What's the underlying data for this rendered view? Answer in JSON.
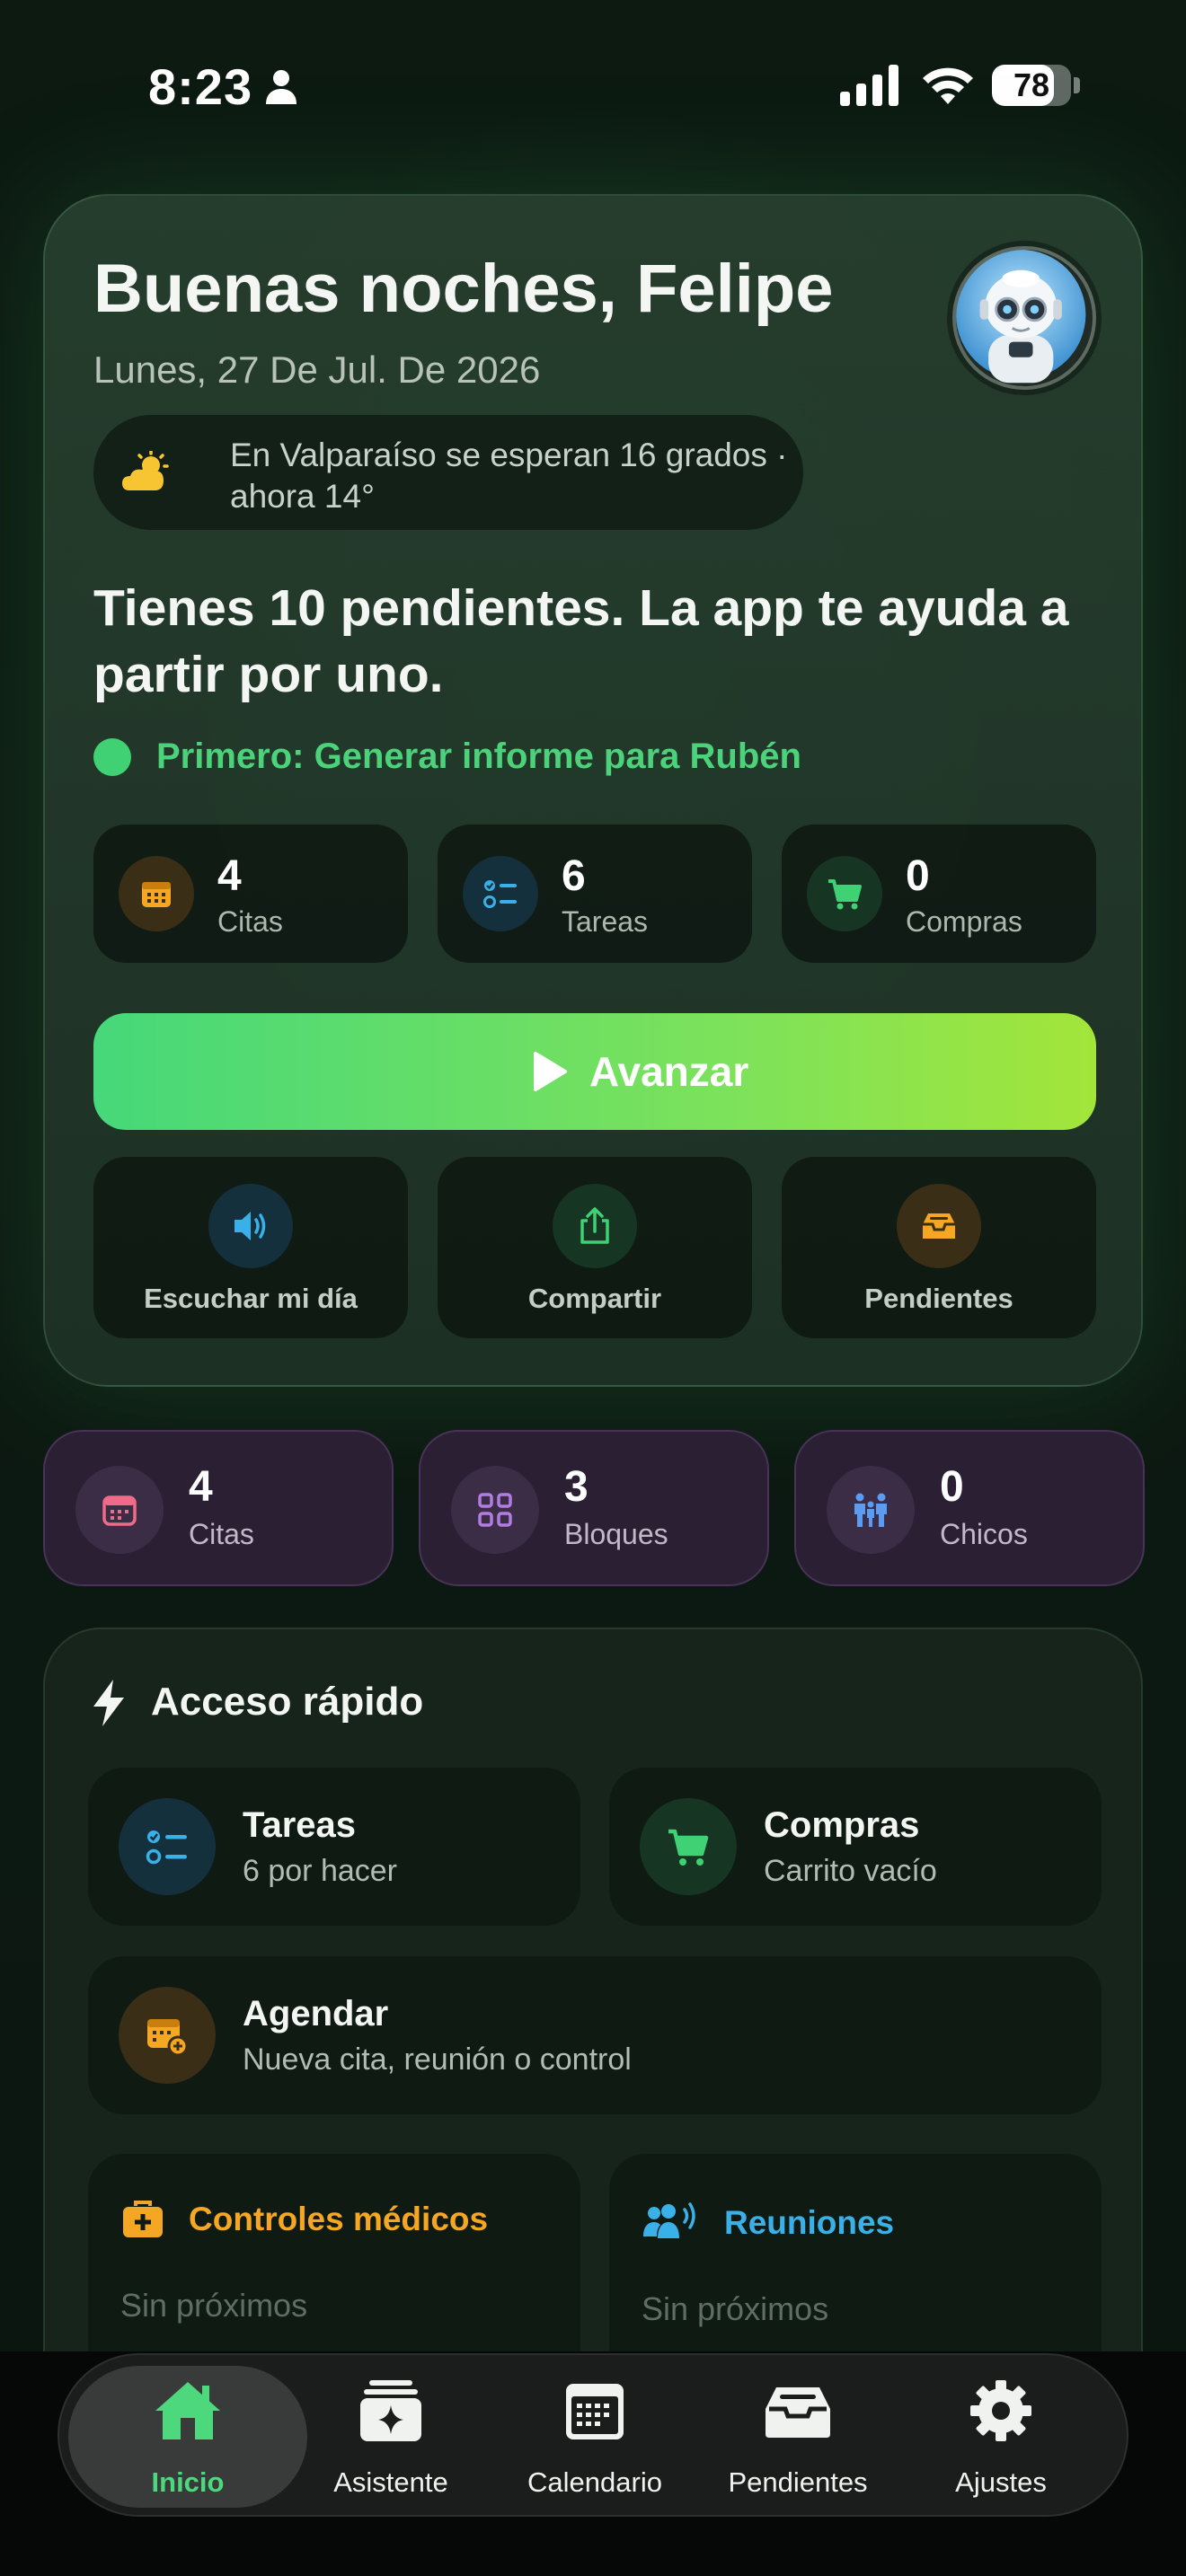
{
  "status_bar": {
    "time": "8:23",
    "battery": "78",
    "battery_level_percent": 78
  },
  "header": {
    "greeting": "Buenas noches, Felipe",
    "date": "Lunes, 27 De Jul. De 2026",
    "weather": "En Valparaíso se esperan 16 grados · ahora 14°",
    "weather_icon": "sun-cloud-icon"
  },
  "summary": {
    "title": "Tienes 10 pendientes. La app te ayuda a partir por uno.",
    "first_task": "Primero: Generar informe para Rubén"
  },
  "stats": [
    {
      "value": "4",
      "label": "Citas",
      "icon": "calendar-icon",
      "color": "#f5a623"
    },
    {
      "value": "6",
      "label": "Tareas",
      "icon": "checklist-icon",
      "color": "#3ab0e8"
    },
    {
      "value": "0",
      "label": "Compras",
      "icon": "cart-icon",
      "color": "#3fd173"
    }
  ],
  "advance_button": {
    "label": "Avanzar"
  },
  "actions": [
    {
      "label": "Escuchar mi día",
      "icon": "speaker-icon",
      "color": "#3ab0e8"
    },
    {
      "label": "Compartir",
      "icon": "share-icon",
      "color": "#3fd173"
    },
    {
      "label": "Pendientes",
      "icon": "inbox-icon",
      "color": "#f5a623"
    }
  ],
  "summary_pills": [
    {
      "value": "4",
      "label": "Citas",
      "icon": "calendar-icon",
      "color": "#f06a8a"
    },
    {
      "value": "3",
      "label": "Bloques",
      "icon": "grid-icon",
      "color": "#b27de0"
    },
    {
      "value": "0",
      "label": "Chicos",
      "icon": "family-icon",
      "color": "#5b9bf0"
    }
  ],
  "quick_access": {
    "title": "Acceso rápido",
    "items": [
      {
        "title": "Tareas",
        "subtitle": "6 por hacer",
        "icon": "checklist-icon"
      },
      {
        "title": "Compras",
        "subtitle": "Carrito vacío",
        "icon": "cart-icon"
      },
      {
        "title": "Agendar",
        "subtitle": "Nueva cita, reunión o control",
        "icon": "calendar-add-icon"
      }
    ],
    "medical": {
      "title": "Controles médicos",
      "subtitle": "Sin próximos",
      "color": "#f5a623"
    },
    "meetings": {
      "title": "Reuniones",
      "subtitle": "Sin próximos",
      "color": "#3ab0e8"
    }
  },
  "tabbar": [
    {
      "label": "Inicio",
      "icon": "home-icon",
      "active": true
    },
    {
      "label": "Asistente",
      "icon": "sparkle-icon",
      "active": false
    },
    {
      "label": "Calendario",
      "icon": "calendar-icon",
      "active": false
    },
    {
      "label": "Pendientes",
      "icon": "inbox-icon",
      "active": false
    },
    {
      "label": "Ajustes",
      "icon": "gear-icon",
      "active": false
    }
  ]
}
